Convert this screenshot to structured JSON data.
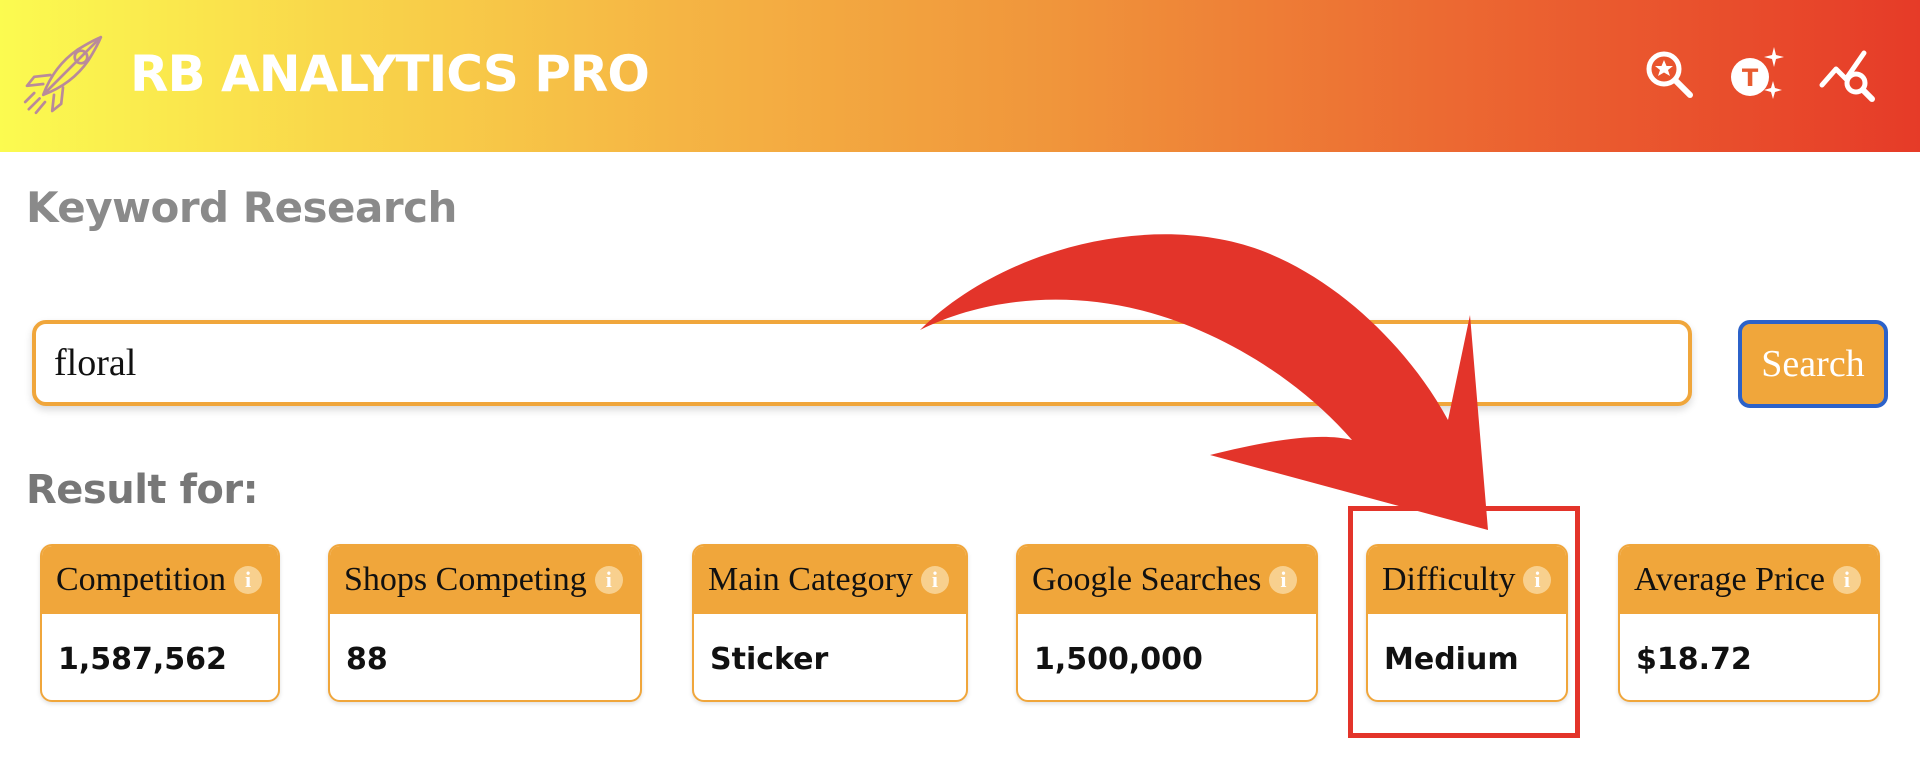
{
  "header": {
    "brand": "RB ANALYTICS PRO",
    "icons": [
      "rocket-logo-icon",
      "search-star-icon",
      "trademark-sparkle-icon",
      "trend-search-icon"
    ]
  },
  "page_title": "Keyword Research",
  "search": {
    "value": "floral",
    "button_label": "Search"
  },
  "results": {
    "title": "Result for:",
    "cards": [
      {
        "label": "Competition",
        "value": "1,587,562"
      },
      {
        "label": "Shops Competing",
        "value": "88"
      },
      {
        "label": "Main Category",
        "value": "Sticker"
      },
      {
        "label": "Google Searches",
        "value": "1,500,000"
      },
      {
        "label": "Difficulty",
        "value": "Medium"
      },
      {
        "label": "Average Price",
        "value": "$18.72"
      }
    ],
    "info_symbol": "i"
  },
  "colors": {
    "accent_orange": "#f0a63b",
    "annotation_red": "#e3342a",
    "button_border_blue": "#2c62c9",
    "header_gradient": [
      "#fbfb50",
      "#f5b544",
      "#e63b28"
    ]
  }
}
